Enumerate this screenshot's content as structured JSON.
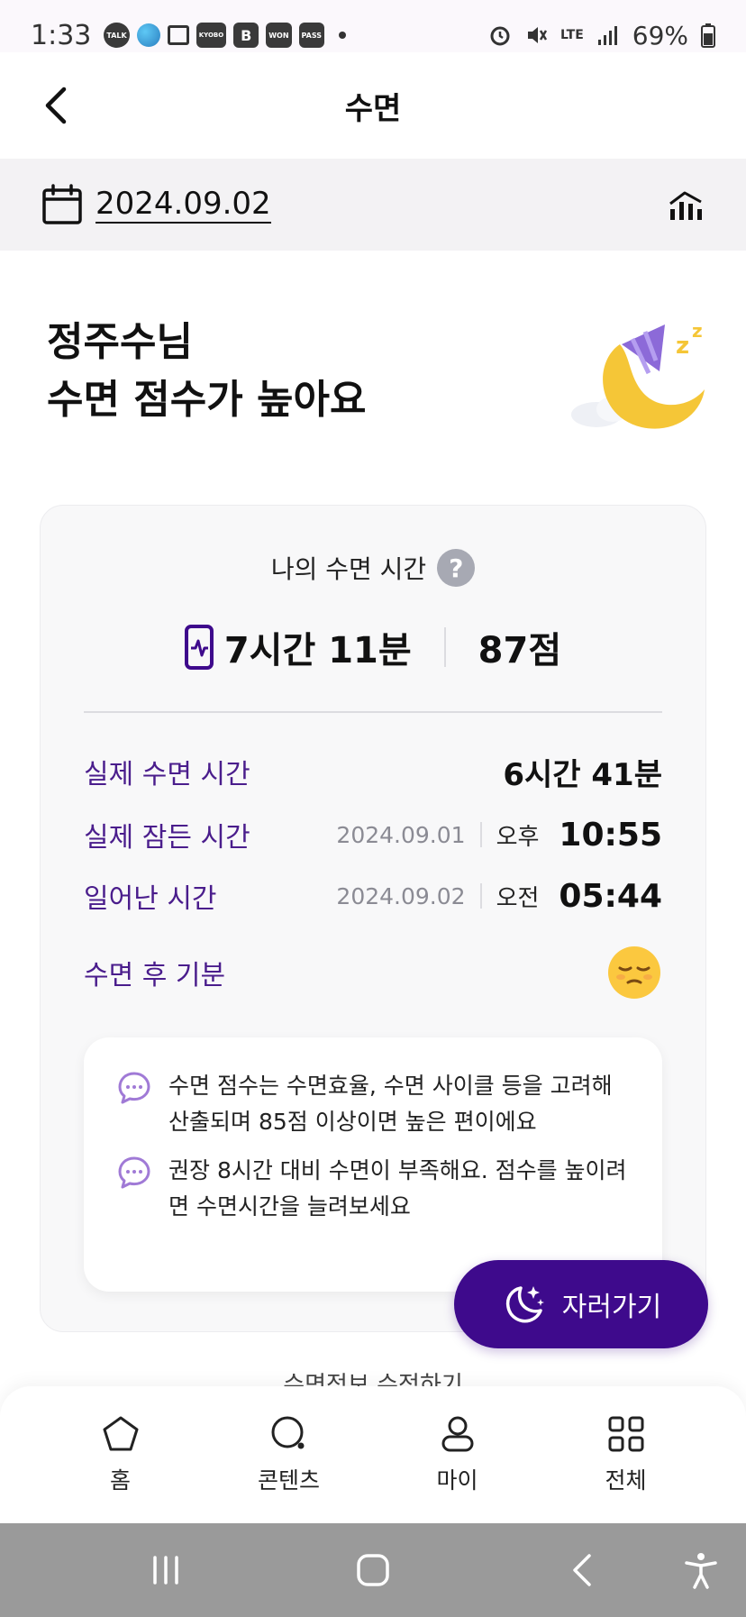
{
  "status_bar": {
    "time": "1:33",
    "chips": [
      "TALK",
      "KYOBO",
      "B",
      "WON",
      "PASS"
    ],
    "network": "LTE",
    "battery": "69%"
  },
  "header": {
    "title": "수면"
  },
  "date_bar": {
    "date": "2024.09.02"
  },
  "greeting": {
    "line1": "정주수님",
    "line2": "수면 점수가 높아요"
  },
  "card": {
    "title": "나의 수면 시간",
    "help_symbol": "?",
    "total_time": "7시간 11분",
    "score": "87점",
    "rows": {
      "actual_sleep": {
        "label": "실제 수면 시간",
        "value": "6시간 41분"
      },
      "fell_asleep": {
        "label": "실제 잠든 시간",
        "date": "2024.09.01",
        "ampm": "오후",
        "time": "10:55"
      },
      "woke_up": {
        "label": "일어난 시간",
        "date": "2024.09.02",
        "ampm": "오전",
        "time": "05:44"
      },
      "mood": {
        "label": "수면 후 기분"
      }
    },
    "info": [
      {
        "text": "수면 점수는 수면효율, 수면 사이클 등을 고려해 산출되며 85점 이상이면 높은 편이에요"
      },
      {
        "text": "권장 8시간 대비 수면이 부족해요. 점수를 높이려면 수면시간을 늘려보세요"
      }
    ]
  },
  "sleep_button": {
    "label": "자러가기"
  },
  "edit_link": {
    "label": "수면정보 수정하기"
  },
  "bottom_nav": [
    {
      "label": "홈",
      "icon": "home-icon"
    },
    {
      "label": "콘텐츠",
      "icon": "search-icon"
    },
    {
      "label": "마이",
      "icon": "person-icon"
    },
    {
      "label": "전체",
      "icon": "grid-icon"
    }
  ],
  "colors": {
    "accent": "#3e0a8c",
    "label_purple": "#4a1d8c",
    "card_bg": "#f8f8f9"
  }
}
